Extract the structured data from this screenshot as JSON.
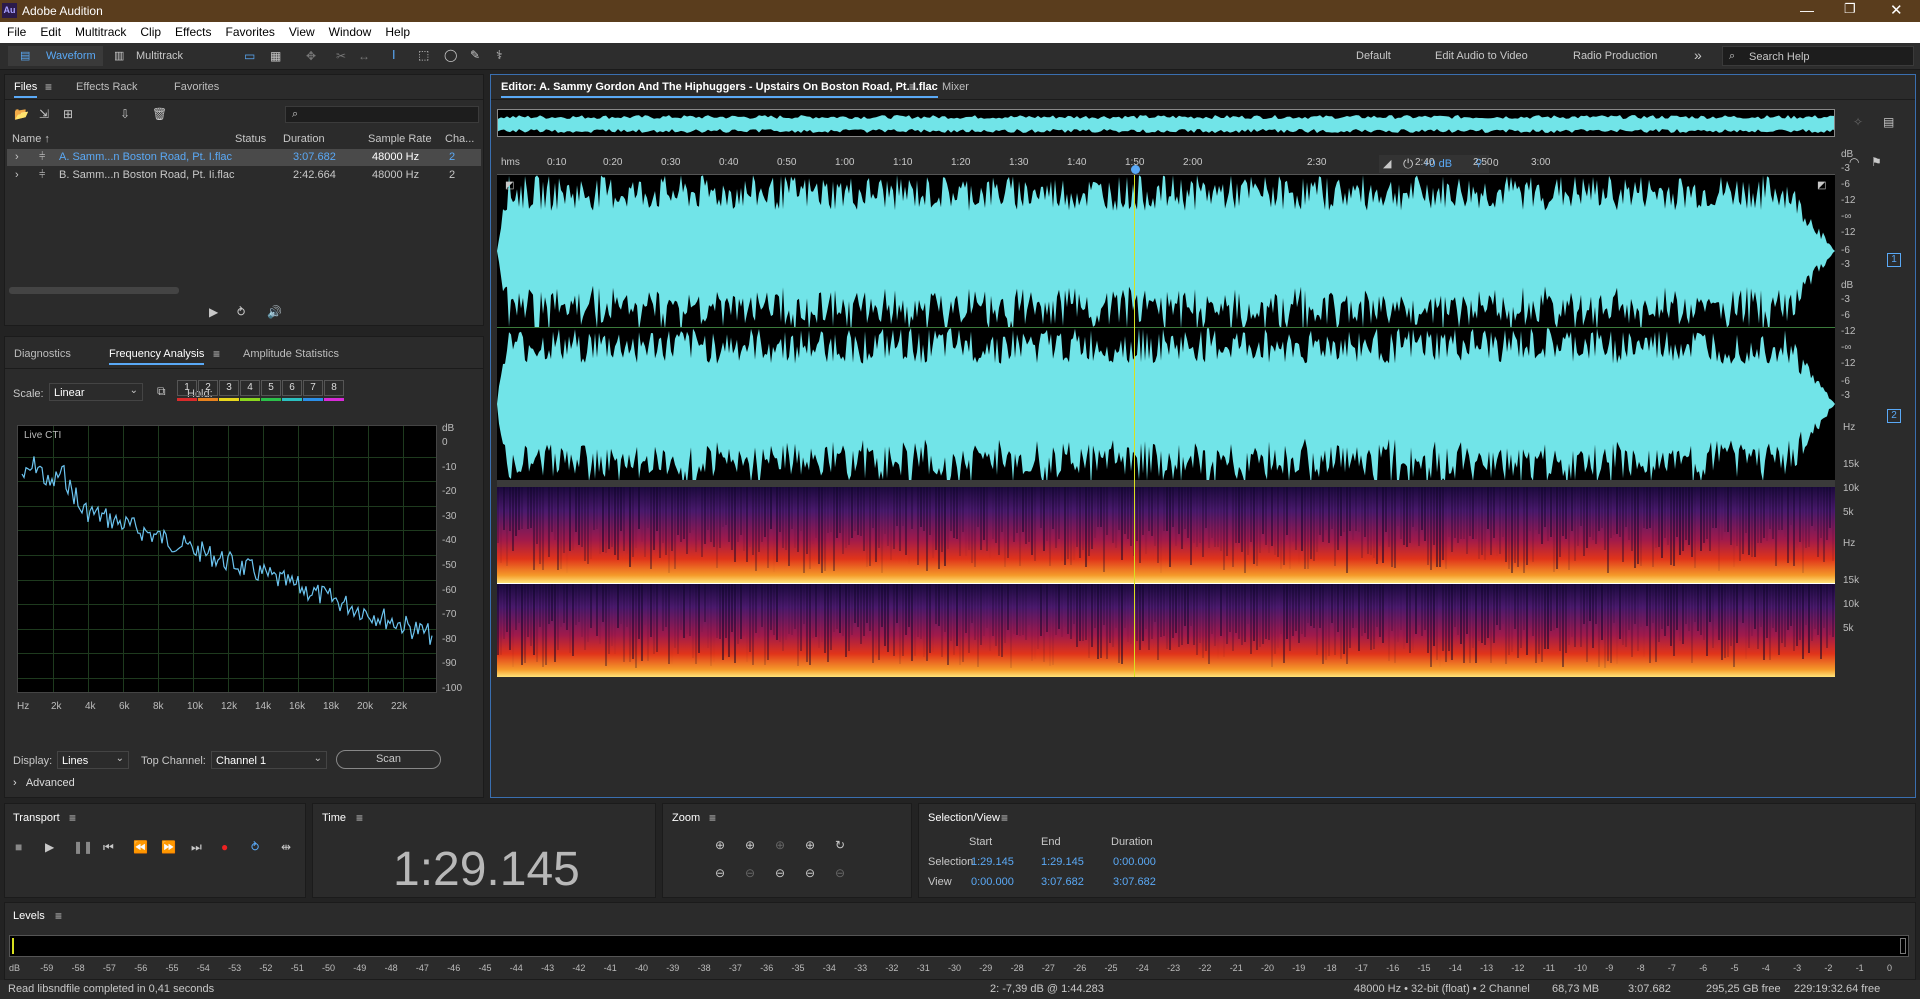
{
  "app": {
    "title": "Adobe Audition",
    "logo": "Au"
  },
  "menu": [
    "File",
    "Edit",
    "Multitrack",
    "Clip",
    "Effects",
    "Favorites",
    "View",
    "Window",
    "Help"
  ],
  "toolbar": {
    "waveform": "Waveform",
    "multitrack": "Multitrack",
    "workspaces": [
      "Default",
      "Edit Audio to Video",
      "Radio Production"
    ],
    "search_placeholder": "Search Help"
  },
  "files_panel": {
    "tabs": [
      "Files",
      "Effects Rack",
      "Favorites"
    ],
    "columns": [
      "Name",
      "Status",
      "Duration",
      "Sample Rate",
      "Cha..."
    ],
    "rows": [
      {
        "name": "A. Samm...n Boston Road, Pt. I.flac",
        "duration": "3:07.682",
        "rate": "48000 Hz",
        "ch": "2"
      },
      {
        "name": "B. Samm...n Boston Road, Pt. Ii.flac",
        "duration": "2:42.664",
        "rate": "48000 Hz",
        "ch": "2"
      }
    ]
  },
  "analysis_panel": {
    "tabs": [
      "Diagnostics",
      "Frequency Analysis",
      "Amplitude Statistics"
    ],
    "scale_label": "Scale:",
    "scale_value": "Linear",
    "hold_label": "Hold:",
    "holds": [
      "1",
      "2",
      "3",
      "4",
      "5",
      "6",
      "7",
      "8"
    ],
    "hold_colors": [
      "#d92b2b",
      "#e8821e",
      "#e8d81e",
      "#8bd81e",
      "#2bc04a",
      "#2bc0c0",
      "#2b8fe8",
      "#d82bd8"
    ],
    "live": "Live CTI",
    "db_label": "dB",
    "db_ticks": [
      "0",
      "-10",
      "-20",
      "-30",
      "-40",
      "-50",
      "-60",
      "-70",
      "-80",
      "-90",
      "-100"
    ],
    "hz_ticks": [
      "Hz",
      "2k",
      "4k",
      "6k",
      "8k",
      "10k",
      "12k",
      "14k",
      "16k",
      "18k",
      "20k",
      "22k"
    ],
    "display_label": "Display:",
    "display_value": "Lines",
    "top_channel_label": "Top Channel:",
    "top_channel_value": "Channel 1",
    "scan": "Scan",
    "advanced": "Advanced"
  },
  "editor": {
    "tab": "Editor: A. Sammy Gordon And The Hiphuggers - Upstairs On Boston Road, Pt. I.flac",
    "mixer": "Mixer",
    "timeline": [
      "hms",
      "0:10",
      "0:20",
      "0:30",
      "0:40",
      "0:50",
      "1:00",
      "1:10",
      "1:20",
      "1:30",
      "1:40",
      "1:50",
      "2:00",
      "2:30",
      "2:40",
      "2:50",
      "3:00"
    ],
    "hud_db": "+0 dB",
    "hud_0": "0",
    "db_scale": [
      "dB",
      "-3",
      "-6",
      "-12",
      "-∞",
      "-12",
      "-6",
      "-3"
    ],
    "hz_scale": [
      "Hz",
      "15k",
      "10k",
      "5k"
    ],
    "channels": [
      "1",
      "2"
    ]
  },
  "transport": {
    "title": "Transport"
  },
  "time": {
    "title": "Time",
    "value": "1:29.145"
  },
  "zoom": {
    "title": "Zoom"
  },
  "selection": {
    "title": "Selection/View",
    "headers": [
      "Start",
      "End",
      "Duration"
    ],
    "rows": [
      {
        "label": "Selection",
        "start": "1:29.145",
        "end": "1:29.145",
        "dur": "0:00.000"
      },
      {
        "label": "View",
        "start": "0:00.000",
        "end": "3:07.682",
        "dur": "3:07.682"
      }
    ]
  },
  "levels": {
    "title": "Levels",
    "ticks": [
      "dB",
      "-59",
      "-58",
      "-57",
      "-56",
      "-55",
      "-54",
      "-53",
      "-52",
      "-51",
      "-50",
      "-49",
      "-48",
      "-47",
      "-46",
      "-45",
      "-44",
      "-43",
      "-42",
      "-41",
      "-40",
      "-39",
      "-38",
      "-37",
      "-36",
      "-35",
      "-34",
      "-33",
      "-32",
      "-31",
      "-30",
      "-29",
      "-28",
      "-27",
      "-26",
      "-25",
      "-24",
      "-23",
      "-22",
      "-21",
      "-20",
      "-19",
      "-18",
      "-17",
      "-16",
      "-15",
      "-14",
      "-13",
      "-12",
      "-11",
      "-10",
      "-9",
      "-8",
      "-7",
      "-6",
      "-5",
      "-4",
      "-3",
      "-2",
      "-1",
      "0"
    ]
  },
  "status": {
    "left": "Read libsndfile completed in 0,41 seconds",
    "cursor": "2: -7,39 dB @ 1:44.283",
    "format": "48000 Hz • 32-bit (float) • 2 Channel",
    "size": "68,73 MB",
    "duration": "3:07.682",
    "free": "295,25 GB free",
    "free_time": "229:19:32.64 free"
  }
}
